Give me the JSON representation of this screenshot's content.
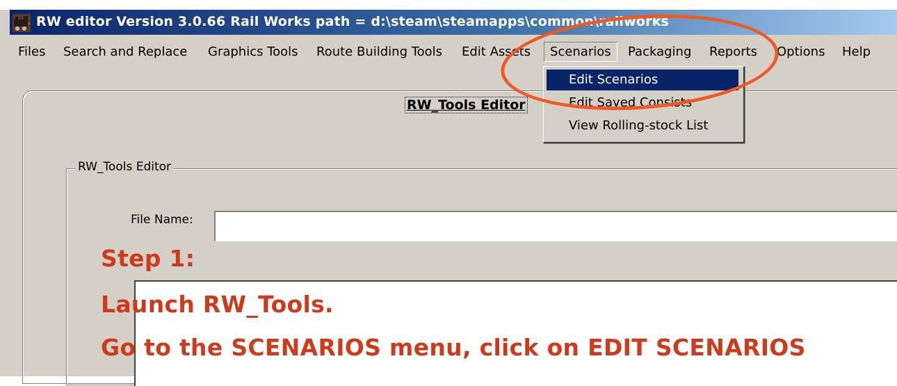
{
  "titlebar": {
    "title": "RW editor  Version 3.0.66   Rail Works path = d:\\steam\\steamapps\\common\\railworks"
  },
  "menubar": {
    "items": [
      {
        "label": "Files"
      },
      {
        "label": "Search and Replace"
      },
      {
        "label": "Graphics Tools"
      },
      {
        "label": "Route Building Tools"
      },
      {
        "label": "Edit Assets"
      },
      {
        "label": "Scenarios"
      },
      {
        "label": "Packaging"
      },
      {
        "label": "Reports"
      },
      {
        "label": "Options"
      },
      {
        "label": "Help"
      }
    ]
  },
  "dropdown": {
    "items": [
      {
        "label": "Edit Scenarios"
      },
      {
        "label": "Edit Saved Consists"
      },
      {
        "label": "View Rolling-stock List"
      }
    ]
  },
  "panel": {
    "title": "RW_Tools Editor",
    "group_label": "RW_Tools Editor",
    "file_label": "File Name:",
    "file_value": ""
  },
  "annotation": {
    "step": "Step 1:",
    "line2": "Launch RW_Tools.",
    "line3": "Go to the SCENARIOS menu, click on EDIT SCENARIOS"
  },
  "colors": {
    "titlebar_start": "#0a246a",
    "titlebar_end": "#a6caf0",
    "window_bg": "#d4d0c8",
    "menu_highlight": "#0a246a",
    "annotation_text": "#cc3b1b",
    "annotation_circle": "#ee5a22"
  },
  "icons": {
    "app_icon": "locomotive-icon"
  }
}
